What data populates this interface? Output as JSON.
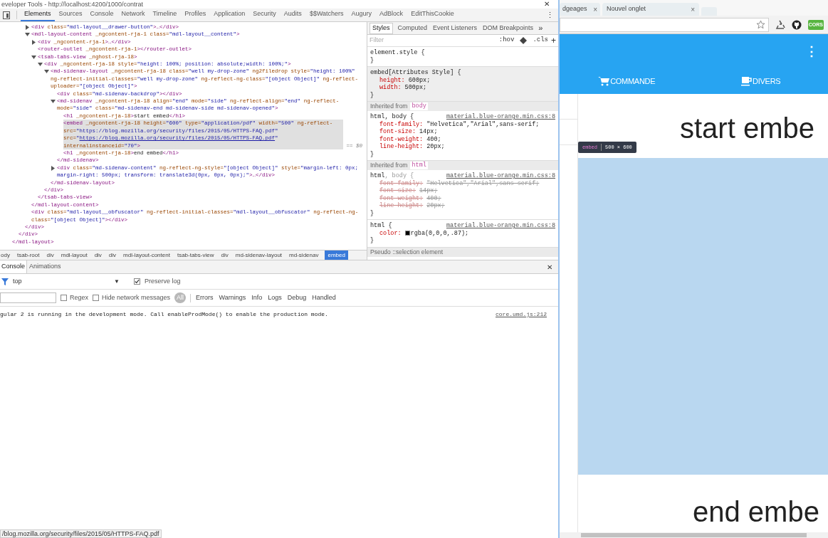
{
  "devtools": {
    "window_title": "eveloper Tools - http://localhost:4200/1000/contrat",
    "close": "✕",
    "menu": "⋮",
    "tabs": [
      {
        "label": "Elements",
        "selected": true
      },
      {
        "label": "Sources",
        "selected": false
      },
      {
        "label": "Console",
        "selected": false
      },
      {
        "label": "Network",
        "selected": false
      },
      {
        "label": "Timeline",
        "selected": false
      },
      {
        "label": "Profiles",
        "selected": false
      },
      {
        "label": "Application",
        "selected": false
      },
      {
        "label": "Security",
        "selected": false
      },
      {
        "label": "Audits",
        "selected": false
      },
      {
        "label": "$$Watchers",
        "selected": false
      },
      {
        "label": "Augury",
        "selected": false
      },
      {
        "label": "AdBlock",
        "selected": false
      },
      {
        "label": "EditThisCookie",
        "selected": false
      }
    ]
  },
  "elements_tree": {
    "nodes": [
      {
        "children": [
          {
            "children": [
              {
                "children": [
                  {
                    "open": [
                      {
                        "kind": "tag",
                        "text": "<div "
                      },
                      {
                        "kind": "attr",
                        "text": "class="
                      },
                      {
                        "kind": "value",
                        "text": "\"mdl-layout__drawer-button\""
                      },
                      {
                        "kind": "tag",
                        "text": ">…</div>"
                      }
                    ],
                    "expanded": false,
                    "selected": false
                  },
                  {
                    "open": [
                      {
                        "kind": "tag",
                        "text": "<mdl-layout-content "
                      },
                      {
                        "kind": "attr",
                        "text": "_ngcontent-rja-1 class="
                      },
                      {
                        "kind": "value",
                        "text": "\"mdl-layout__content\""
                      },
                      {
                        "kind": "tag",
                        "text": ">"
                      }
                    ],
                    "expanded": true,
                    "selected": false,
                    "children": [
                      {
                        "open": [
                          {
                            "kind": "tag",
                            "text": "<div "
                          },
                          {
                            "kind": "attr",
                            "text": "_ngcontent-rja-1"
                          },
                          {
                            "kind": "tag",
                            "text": ">…</div>"
                          }
                        ],
                        "expanded": false,
                        "selected": false
                      },
                      {
                        "open": [
                          {
                            "kind": "tag",
                            "text": "<router-outlet "
                          },
                          {
                            "kind": "attr",
                            "text": "_ngcontent-rja-1"
                          },
                          {
                            "kind": "tag",
                            "text": "></router-outlet>"
                          }
                        ],
                        "selected": false
                      },
                      {
                        "open": [
                          {
                            "kind": "tag",
                            "text": "<tsab-tabs-view "
                          },
                          {
                            "kind": "attr",
                            "text": "_nghost-rja-18"
                          },
                          {
                            "kind": "tag",
                            "text": ">"
                          }
                        ],
                        "expanded": true,
                        "selected": false,
                        "children": [
                          {
                            "open": [
                              {
                                "kind": "tag",
                                "text": "<div "
                              },
                              {
                                "kind": "attr",
                                "text": "_ngcontent-rja-18 style="
                              },
                              {
                                "kind": "value",
                                "text": "\"height: 100%; position: absolute;width: 100%;\""
                              },
                              {
                                "kind": "tag",
                                "text": ">"
                              }
                            ],
                            "expanded": true,
                            "selected": false,
                            "children": [
                              {
                                "open": [
                                  {
                                    "kind": "tag",
                                    "text": "<md-sidenav-layout "
                                  },
                                  {
                                    "kind": "attr",
                                    "text": "_ngcontent-rja-18 class="
                                  },
                                  {
                                    "kind": "value",
                                    "text": "\"well my-drop-zone\""
                                  },
                                  {
                                    "kind": "attr",
                                    "text": " ng2filedrop style="
                                  },
                                  {
                                    "kind": "value",
                                    "text": "\"height: 100%\""
                                  },
                                  {
                                    "kind": "attr",
                                    "text": " ng-reflect-initial-classes="
                                  },
                                  {
                                    "kind": "value",
                                    "text": "\"well my-drop-zone\""
                                  },
                                  {
                                    "kind": "attr",
                                    "text": " ng-reflect-ng-class="
                                  },
                                  {
                                    "kind": "value",
                                    "text": "\"[object Object]\""
                                  },
                                  {
                                    "kind": "attr",
                                    "text": " ng-reflect-uploader="
                                  },
                                  {
                                    "kind": "value",
                                    "text": "\"[object Object]\""
                                  },
                                  {
                                    "kind": "tag",
                                    "text": ">"
                                  }
                                ],
                                "expanded": true,
                                "selected": false,
                                "children": [
                                  {
                                    "open": [
                                      {
                                        "kind": "tag",
                                        "text": "<div "
                                      },
                                      {
                                        "kind": "attr",
                                        "text": "class="
                                      },
                                      {
                                        "kind": "value",
                                        "text": "\"md-sidenav-backdrop\""
                                      },
                                      {
                                        "kind": "tag",
                                        "text": "></div>"
                                      }
                                    ],
                                    "selected": false
                                  },
                                  {
                                    "open": [
                                      {
                                        "kind": "tag",
                                        "text": "<md-sidenav "
                                      },
                                      {
                                        "kind": "attr",
                                        "text": "_ngcontent-rja-18 align="
                                      },
                                      {
                                        "kind": "value",
                                        "text": "\"end\""
                                      },
                                      {
                                        "kind": "attr",
                                        "text": " mode="
                                      },
                                      {
                                        "kind": "value",
                                        "text": "\"side\""
                                      },
                                      {
                                        "kind": "attr",
                                        "text": " ng-reflect-align="
                                      },
                                      {
                                        "kind": "value",
                                        "text": "\"end\""
                                      },
                                      {
                                        "kind": "attr",
                                        "text": " ng-reflect-mode="
                                      },
                                      {
                                        "kind": "value",
                                        "text": "\"side\""
                                      },
                                      {
                                        "kind": "attr",
                                        "text": " class="
                                      },
                                      {
                                        "kind": "value",
                                        "text": "\"md-sidenav-end md-sidenav-side md-sidenav-opened\""
                                      },
                                      {
                                        "kind": "tag",
                                        "text": ">"
                                      }
                                    ],
                                    "expanded": true,
                                    "selected": false,
                                    "children": [
                                      {
                                        "open": [
                                          {
                                            "kind": "tag",
                                            "text": "<h1 "
                                          },
                                          {
                                            "kind": "attr",
                                            "text": "_ngcontent-rja-18"
                                          },
                                          {
                                            "kind": "tag",
                                            "text": ">"
                                          },
                                          {
                                            "kind": "text",
                                            "text": "start embed"
                                          },
                                          {
                                            "kind": "tag",
                                            "text": "</h1>"
                                          }
                                        ],
                                        "selected": false
                                      },
                                      {
                                        "open": [
                                          {
                                            "kind": "tag",
                                            "text": "<embed "
                                          },
                                          {
                                            "kind": "attr",
                                            "text": "_ngcontent-rja-18 height="
                                          },
                                          {
                                            "kind": "value",
                                            "text": "\"600\""
                                          },
                                          {
                                            "kind": "attr",
                                            "text": " type="
                                          },
                                          {
                                            "kind": "value",
                                            "text": "\"application/pdf\""
                                          },
                                          {
                                            "kind": "attr",
                                            "text": " width="
                                          },
                                          {
                                            "kind": "value",
                                            "text": "\"500\""
                                          },
                                          {
                                            "kind": "attr",
                                            "text": " ng-reflect-src="
                                          },
                                          {
                                            "kind": "value",
                                            "text": "\"https://blog.mozilla.org/security/files/2015/05/HTTPS-FAQ.pdf\""
                                          },
                                          {
                                            "kind": "attr",
                                            "text": " src="
                                          },
                                          {
                                            "kind": "value",
                                            "text": "\""
                                          },
                                          {
                                            "kind": "link",
                                            "text": "https://blog.mozilla.org/security/files/2015/05/HTTPS-FAQ.pdf"
                                          },
                                          {
                                            "kind": "value",
                                            "text": "\""
                                          },
                                          {
                                            "kind": "attr",
                                            "text": " internalinstanceid="
                                          },
                                          {
                                            "kind": "value",
                                            "text": "\"70\""
                                          },
                                          {
                                            "kind": "tag",
                                            "text": ">"
                                          }
                                        ],
                                        "selected": true,
                                        "console_ref": "== $0"
                                      },
                                      {
                                        "open": [
                                          {
                                            "kind": "tag",
                                            "text": "<h1 "
                                          },
                                          {
                                            "kind": "attr",
                                            "text": "_ngcontent-rja-18"
                                          },
                                          {
                                            "kind": "tag",
                                            "text": ">"
                                          },
                                          {
                                            "kind": "text",
                                            "text": "end embed"
                                          },
                                          {
                                            "kind": "tag",
                                            "text": "</h1>"
                                          }
                                        ],
                                        "selected": false
                                      }
                                    ],
                                    "close": [
                                      {
                                        "kind": "tag",
                                        "text": "</md-sidenav>"
                                      }
                                    ]
                                  },
                                  {
                                    "open": [
                                      {
                                        "kind": "tag",
                                        "text": "<div "
                                      },
                                      {
                                        "kind": "attr",
                                        "text": "class="
                                      },
                                      {
                                        "kind": "value",
                                        "text": "\"md-sidenav-content\""
                                      },
                                      {
                                        "kind": "attr",
                                        "text": " ng-reflect-ng-style="
                                      },
                                      {
                                        "kind": "value",
                                        "text": "\"[object Object]\""
                                      },
                                      {
                                        "kind": "attr",
                                        "text": " style="
                                      },
                                      {
                                        "kind": "value",
                                        "text": "\"margin-left: 0px; margin-right: 500px; transform: translate3d(0px, 0px, 0px);\""
                                      },
                                      {
                                        "kind": "tag",
                                        "text": ">…</div>"
                                      }
                                    ],
                                    "expanded": false,
                                    "selected": false
                                  }
                                ],
                                "close": [
                                  {
                                    "kind": "tag",
                                    "text": "</md-sidenav-layout>"
                                  }
                                ]
                              }
                            ],
                            "close": [
                              {
                                "kind": "tag",
                                "text": "</div>"
                              }
                            ]
                          }
                        ],
                        "close": [
                          {
                            "kind": "tag",
                            "text": "</tsab-tabs-view>"
                          }
                        ]
                      }
                    ],
                    "close": [
                      {
                        "kind": "tag",
                        "text": "</mdl-layout-content>"
                      }
                    ]
                  },
                  {
                    "open": [
                      {
                        "kind": "tag",
                        "text": "<div "
                      },
                      {
                        "kind": "attr",
                        "text": "class="
                      },
                      {
                        "kind": "value",
                        "text": "\"mdl-layout__obfuscator\""
                      },
                      {
                        "kind": "attr",
                        "text": " ng-reflect-initial-classes="
                      },
                      {
                        "kind": "value",
                        "text": "\"mdl-layout__obfuscator\""
                      },
                      {
                        "kind": "attr",
                        "text": " ng-reflect-ng-class="
                      },
                      {
                        "kind": "value",
                        "text": "\"[object Object]\""
                      },
                      {
                        "kind": "tag",
                        "text": "></div>"
                      }
                    ],
                    "selected": false
                  }
                ],
                "close": [
                  {
                    "kind": "tag",
                    "text": "</div>"
                  }
                ]
              }
            ],
            "close": [
              {
                "kind": "tag",
                "text": "</div>"
              }
            ]
          }
        ],
        "close": [
          {
            "kind": "tag",
            "text": "</mdl-layout>"
          }
        ]
      }
    ]
  },
  "breadcrumbs": [
    {
      "label": "ody",
      "selected": false
    },
    {
      "label": "tsab-root",
      "selected": false
    },
    {
      "label": "div",
      "selected": false
    },
    {
      "label": "mdl-layout",
      "selected": false
    },
    {
      "label": "div",
      "selected": false
    },
    {
      "label": "div",
      "selected": false
    },
    {
      "label": "mdl-layout-content",
      "selected": false
    },
    {
      "label": "tsab-tabs-view",
      "selected": false
    },
    {
      "label": "div",
      "selected": false
    },
    {
      "label": "md-sidenav-layout",
      "selected": false
    },
    {
      "label": "md-sidenav",
      "selected": false
    },
    {
      "label": "embed",
      "selected": true
    }
  ],
  "styles_pane": {
    "tabs": [
      {
        "label": "Styles",
        "selected": true
      },
      {
        "label": "Computed",
        "selected": false
      },
      {
        "label": "Event Listeners",
        "selected": false
      },
      {
        "label": "DOM Breakpoints",
        "selected": false
      }
    ],
    "more": "»",
    "filter": {
      "placeholder": "Filter"
    },
    "hov": ":hov",
    "cls": ".cls",
    "add": "+",
    "sections": [
      {
        "kind": "rule",
        "selector": "element.style {",
        "shaded": false,
        "end": "}"
      },
      {
        "kind": "rule",
        "selector": "embed[Attributes Style] {",
        "shaded": true,
        "properties": [
          {
            "name": "height:",
            "value": "600px;",
            "overridden": false
          },
          {
            "name": "width:",
            "value": "500px;",
            "overridden": false
          }
        ],
        "end": "}"
      },
      {
        "kind": "inherited",
        "label": "Inherited from",
        "from": "body"
      },
      {
        "kind": "rule",
        "selector": "html, body {",
        "source": "material.blue-orange.min.css:8",
        "shaded": false,
        "properties": [
          {
            "name": "font-family:",
            "value": "\"Helvetica\",\"Arial\",sans-serif;",
            "overridden": false
          },
          {
            "name": "font-size:",
            "value": "14px;",
            "overridden": false
          },
          {
            "name": "font-weight:",
            "value": "400;",
            "overridden": false
          },
          {
            "name": "line-height:",
            "value": "20px;",
            "overridden": false
          }
        ],
        "end": "}"
      },
      {
        "kind": "inherited",
        "label": "Inherited from",
        "from": "html"
      },
      {
        "kind": "rule",
        "selector": "html",
        "selector_dim": ", body {",
        "source": "material.blue-orange.min.css:8",
        "shaded": false,
        "properties": [
          {
            "name": "font-family:",
            "value": "\"Helvetica\",\"Arial\",sans-serif;",
            "overridden": true
          },
          {
            "name": "font-size:",
            "value": "14px;",
            "overridden": true
          },
          {
            "name": "font-weight:",
            "value": "400;",
            "overridden": true
          },
          {
            "name": "line-height:",
            "value": "20px;",
            "overridden": true
          }
        ],
        "end": "}"
      },
      {
        "kind": "rule",
        "selector": "html {",
        "source": "material.blue-orange.min.css:8",
        "shaded": false,
        "properties": [
          {
            "name": "color:",
            "value": "rgba(0,0,0,.87);",
            "overridden": false,
            "has_swatch": true
          }
        ],
        "end": "}"
      },
      {
        "kind": "pseudo",
        "label": "Pseudo ::selection element"
      }
    ]
  },
  "drawer": {
    "tabs": [
      {
        "label": "Console",
        "selected": true
      },
      {
        "label": "Animations",
        "selected": false
      }
    ],
    "close": "✕",
    "context": "top",
    "context_caret": "▼",
    "preserve_log": {
      "label": "Preserve log",
      "checked": true
    },
    "filter_options": [
      {
        "label": "Regex",
        "checked": false
      },
      {
        "label": "Hide network messages",
        "checked": false
      }
    ],
    "levels": [
      {
        "label": "All",
        "selected": true
      },
      {
        "label": "Errors",
        "selected": false
      },
      {
        "label": "Warnings",
        "selected": false
      },
      {
        "label": "Info",
        "selected": false
      },
      {
        "label": "Logs",
        "selected": false
      },
      {
        "label": "Debug",
        "selected": false
      },
      {
        "label": "Handled",
        "selected": false
      }
    ],
    "messages": [
      {
        "text": "gular 2 is running in the development mode. Call enableProdMode() to enable the production mode.",
        "source": "core.umd.js:212"
      }
    ]
  },
  "status_url": "/blog.mozilla.org/security/files/2015/05/HTTPS-FAQ.pdf",
  "browser": {
    "tabs": [
      {
        "title": "dgeages",
        "close": "×"
      },
      {
        "title": "Nouvel onglet",
        "close": "×"
      }
    ],
    "extensions": [
      {
        "kind": "recycle"
      },
      {
        "kind": "github"
      },
      {
        "kind": "cors",
        "label": "CORS"
      }
    ],
    "app": {
      "menu": "⋮",
      "nav_tabs": [
        {
          "label": "COMMANDE"
        },
        {
          "label": "DIVERS"
        }
      ],
      "heading_top": "start embe",
      "tooltip": {
        "tag": "embed",
        "size": "500 × 600"
      },
      "heading_bottom": "end embe"
    }
  }
}
